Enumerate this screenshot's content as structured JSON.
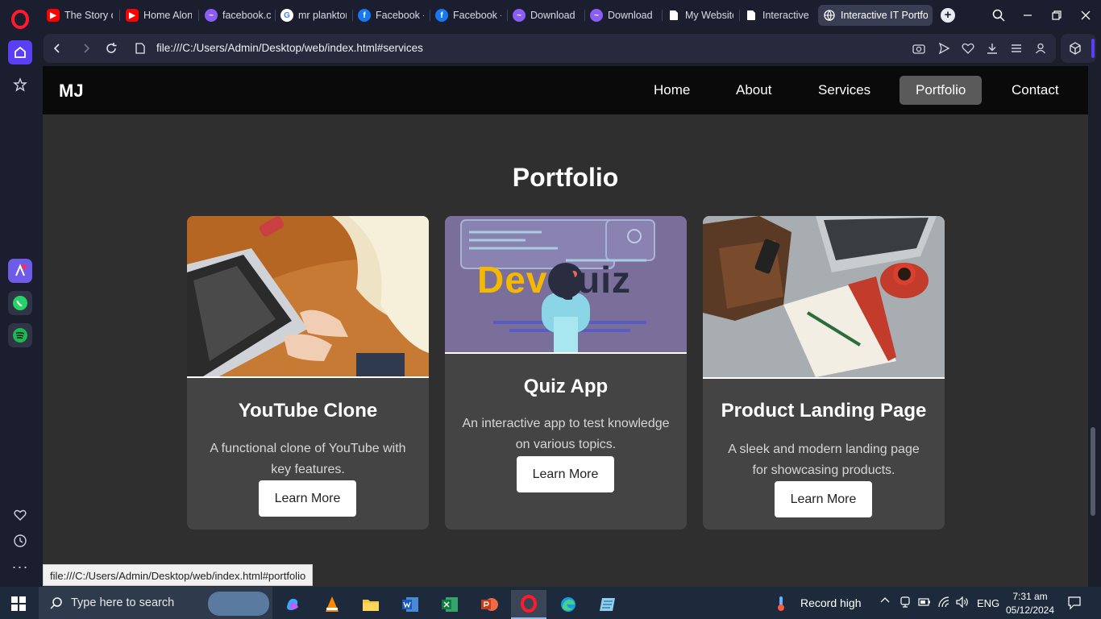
{
  "browser": {
    "tabs": [
      {
        "title": "The Story of",
        "favicon": "youtube-icon",
        "color": "#ff0000"
      },
      {
        "title": "Home Alone",
        "favicon": "youtube-icon",
        "color": "#ff0000"
      },
      {
        "title": "facebook.co",
        "favicon": "messenger-icon",
        "color": "#8b5cf6"
      },
      {
        "title": "mr plankton",
        "favicon": "google-icon",
        "color": "#ffffff"
      },
      {
        "title": "Facebook - I",
        "favicon": "facebook-icon",
        "color": "#1877f2"
      },
      {
        "title": "Facebook - I",
        "favicon": "facebook-icon",
        "color": "#1877f2"
      },
      {
        "title": "Download M",
        "favicon": "messenger-icon",
        "color": "#8b5cf6"
      },
      {
        "title": "Download M",
        "favicon": "messenger-icon",
        "color": "#8b5cf6"
      },
      {
        "title": "My Website",
        "favicon": "file-icon",
        "color": "#ffffff"
      },
      {
        "title": "Interactive I",
        "favicon": "file-icon",
        "color": "#ffffff"
      },
      {
        "title": "Interactive IT Portfolio",
        "favicon": "globe-icon",
        "color": "#ffffff",
        "active": true
      }
    ],
    "url": "file:///C:/Users/Admin/Desktop/web/index.html#services",
    "status_url": "file:///C:/Users/Admin/Desktop/web/index.html#portfolio"
  },
  "site": {
    "brand": "MJ",
    "nav": [
      "Home",
      "About",
      "Services",
      "Portfolio",
      "Contact"
    ],
    "active_nav": "Portfolio",
    "section_title": "Portfolio",
    "cards": [
      {
        "title": "YouTube Clone",
        "description": "A functional clone of YouTube with key features.",
        "button": "Learn More",
        "image": "laptop-typing-photo"
      },
      {
        "title": "Quiz App",
        "description": "An interactive app to test knowledge on various topics.",
        "button": "Learn More",
        "image": "devquiz-banner",
        "image_text_1": "Dev",
        "image_text_2": "Quiz"
      },
      {
        "title": "Product Landing Page",
        "description": "A sleek and modern landing page for showcasing products.",
        "button": "Learn More",
        "image": "desk-notebook-photo"
      }
    ]
  },
  "taskbar": {
    "search_placeholder": "Type here to search",
    "weather_text": "Record high",
    "language": "ENG",
    "time": "7:31 am",
    "date": "05/12/2024"
  },
  "colors": {
    "opera_red": "#ff1b2d",
    "opera_accent": "#5b3ff5",
    "page_bg": "#2f2f2f",
    "nav_bg": "#0a0a0a",
    "card_bg": "#444444",
    "devquiz_yellow": "#f5b800"
  }
}
